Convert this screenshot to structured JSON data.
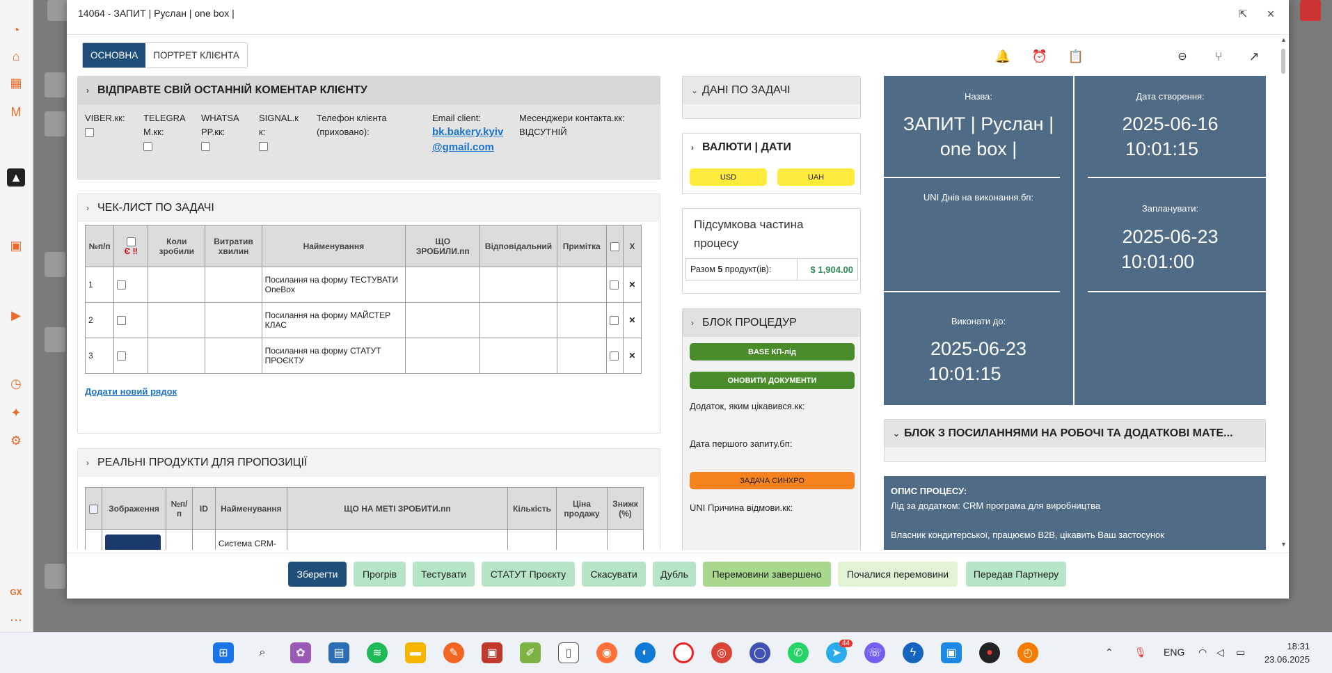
{
  "modal": {
    "title": "14064 - ЗАПИТ | Руслан | one box |"
  },
  "tabs": [
    {
      "label": "ОСНОВНА",
      "active": true
    },
    {
      "label": "ПОРТРЕТ КЛІЄНТА",
      "active": false
    }
  ],
  "comment_panel": {
    "title": "ВІДПРАВТЕ СВІЙ ОСТАННІЙ КОМЕНТАР КЛІЄНТУ",
    "viber": "VIBER.кк:",
    "telegram_1": "TELEGRA",
    "telegram_2": "M.кк:",
    "whatsapp_1": "WHATSA",
    "whatsapp_2": "PP.кк:",
    "signal_1": "SIGNAL.к",
    "signal_2": "к:",
    "phone_1": "Телефон клієнта",
    "phone_2": "(приховано):",
    "email_label": "Email client:",
    "email_1": "bk.bakery.kyiv",
    "email_2": "@gmail.com",
    "messengers_label": "Месенджери контакта.кк:",
    "messengers_value": "ВІДСУТНІЙ"
  },
  "checklist": {
    "title": "ЧЕК-ЛИСТ ПО ЗАДАЧІ",
    "headers": [
      "№п/п",
      "Є ‼",
      "Коли зробили",
      "Витратив хвилин",
      "Найменування",
      "ЩО ЗРОБИЛИ.пп",
      "Відповідальний",
      "Примітка",
      "",
      "X"
    ],
    "rows": [
      {
        "n": "1",
        "name": "Посилання на форму ТЕСТУВАТИ OneBox"
      },
      {
        "n": "2",
        "name": "Посилання на форму МАЙСТЕР КЛАС"
      },
      {
        "n": "3",
        "name": "Посилання на форму СТАТУТ ПРОЄКТУ"
      }
    ],
    "add_row": "Додати новий рядок"
  },
  "products": {
    "title": "РЕАЛЬНІ ПРОДУКТИ ДЛЯ ПРОПОЗИЦІЇ",
    "headers": [
      "Зображення",
      "№п/п",
      "ID",
      "Найменування",
      "ЩО НА МЕТІ ЗРОБИТИ.пп",
      "Кількість",
      "Ціна продажу",
      "Знижк (%)"
    ],
    "row_name": "Система CRM-"
  },
  "task_data": {
    "title": "ДАНІ ПО ЗАДАЧІ"
  },
  "currency": {
    "title": "ВАЛЮТИ | ДАТИ",
    "usd": "USD",
    "uah": "UAH"
  },
  "summary": {
    "title": "Підсумкова частина процесу",
    "total_prefix": "Разом",
    "total_count": "5",
    "total_suffix": "продукт(ів):",
    "total_amount": "$  1,904.00"
  },
  "procedures": {
    "title": "БЛОК ПРОЦЕДУР",
    "btn_base": "BASE КП-лід",
    "btn_update": "ОНОВИТИ ДОКУМЕНТИ",
    "addon_label": "Додаток, яким цікавився.кк:",
    "first_request_label": "Дата першого запиту.бп:",
    "btn_sync": "ЗАДАЧА СИНХРО",
    "reason_label": "UNI Причина відмови.кк:"
  },
  "info": {
    "name_label": "Назва:",
    "name_value": "ЗАПИТ | Руслан | one box |",
    "created_label": "Дата створення:",
    "created_date": "2025-06-16",
    "created_time": "10:01:15",
    "days_label": "UNI Днів на виконання.бп:",
    "planned_label": "Запланувати:",
    "planned_date": "2025-06-23",
    "planned_time": "10:01:00",
    "due_label": "Виконати до:",
    "due_date": "2025-06-23",
    "due_time": "10:01:15"
  },
  "links_block": {
    "title": "БЛОК З ПОСИЛАННЯМИ НА РОБОЧІ ТА ДОДАТКОВІ МАТЕ..."
  },
  "process_desc": {
    "title": "ОПИС ПРОЦЕСУ:",
    "line1": "Лід за додатком: CRM програма для виробництва",
    "line2": "Власник кондитерської, працюємо B2B, цікавить Ваш застосунок"
  },
  "footer": {
    "save": "Зберегти",
    "warmup": "Прогрів",
    "test": "Тестувати",
    "statute": "СТАТУТ Проєкту",
    "cancel": "Скасувати",
    "duplicate": "Дубль",
    "negotiations_done": "Перемовини завершено",
    "negotiations_started": "Почалися перемовини",
    "partner": "Передав Партнеру"
  },
  "taskbar": {
    "lang": "ENG",
    "time": "18:31",
    "date": "23.06.2025",
    "telegram_badge": "44"
  },
  "colors": {
    "primary": "#1f4e79",
    "info_card": "#4f6b85",
    "green_btn": "#4a8b2c",
    "yellow_btn": "#ffeb3b",
    "orange_btn": "#f5821f",
    "footer_green": "#b6e4c6"
  }
}
